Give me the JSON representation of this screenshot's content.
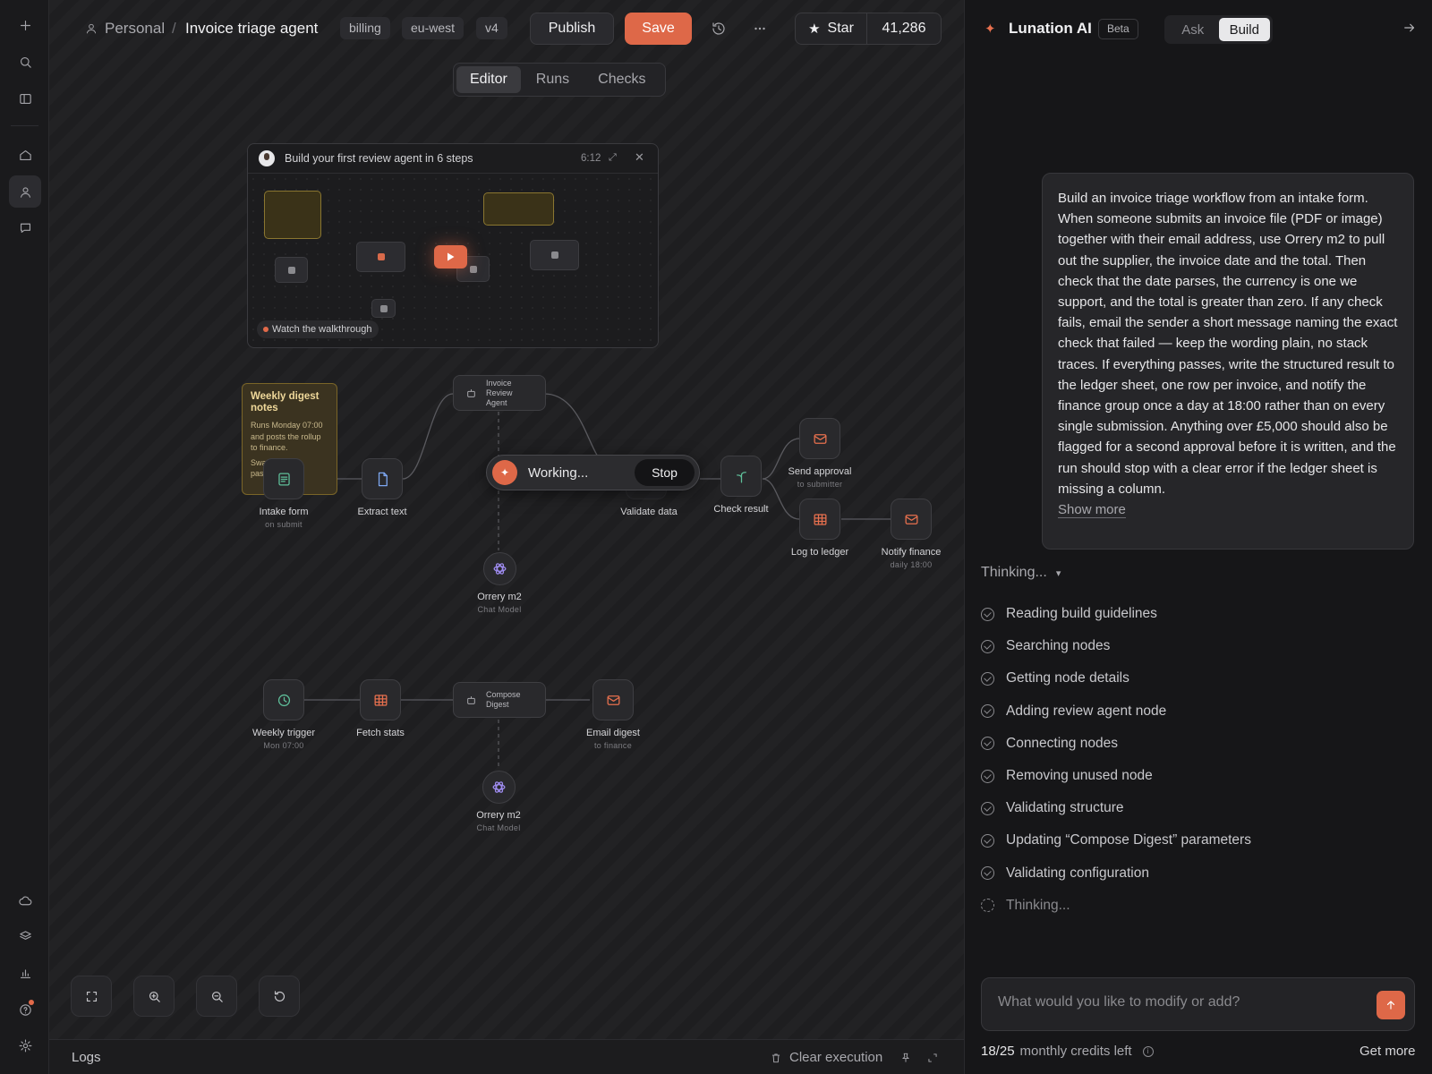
{
  "breadcrumb": {
    "workspace": "Personal",
    "separator": "/",
    "title": "Invoice triage agent"
  },
  "tags": [
    "billing",
    "eu-west",
    "v4"
  ],
  "toolbar": {
    "publish_label": "Publish",
    "save_label": "Save",
    "star_label": "Star",
    "star_count": "41,286"
  },
  "view_tabs": [
    {
      "label": "Editor",
      "active": true
    },
    {
      "label": "Runs",
      "active": false
    },
    {
      "label": "Checks",
      "active": false
    }
  ],
  "walkthrough": {
    "title": "Build your first review agent in 6 steps",
    "duration": "6:12",
    "watch_label": "Watch the walkthrough"
  },
  "sticky_note": {
    "title": "Weekly digest notes",
    "body": "Runs Monday 07:00 and posts the rollup to finance.",
    "body_more": "Swap... node... pass..."
  },
  "workflow": {
    "nodes": {
      "intake_form": {
        "label": "Intake form",
        "sub": "on submit"
      },
      "extract_text": {
        "label": "Extract text"
      },
      "review_agent": {
        "label": "Invoice Review Agent"
      },
      "validate_data": {
        "label": "Validate data"
      },
      "check_result": {
        "label": "Check result"
      },
      "send_approval": {
        "label": "Send approval",
        "sub": "to submitter"
      },
      "log_ledger": {
        "label": "Log to ledger"
      },
      "notify_finance": {
        "label": "Notify finance",
        "sub": "daily 18:00"
      },
      "model_1": {
        "label": "Orrery m2",
        "sub": "Chat Model"
      },
      "weekly_trigger": {
        "label": "Weekly trigger",
        "sub": "Mon 07:00"
      },
      "fetch_stats": {
        "label": "Fetch stats"
      },
      "compose_digest": {
        "label": "Compose Digest"
      },
      "email_digest": {
        "label": "Email digest",
        "sub": "to finance"
      },
      "model_2": {
        "label": "Orrery m2",
        "sub": "Chat Model"
      }
    },
    "working": {
      "status": "Working...",
      "stop_label": "Stop"
    }
  },
  "logs": {
    "title": "Logs",
    "clear_label": "Clear execution"
  },
  "assistant": {
    "name": "Lunation AI",
    "badge": "Beta",
    "modes": [
      {
        "label": "Ask",
        "active": false
      },
      {
        "label": "Build",
        "active": true
      }
    ],
    "prompt": "Build an invoice triage workflow from an intake form. When someone submits an invoice file (PDF or image) together with their email address, use Orrery m2 to pull out the supplier, the invoice date and the total. Then check that the date parses, the currency is one we support, and the total is greater than zero. If any check fails, email the sender a short message naming the exact check that failed — keep the wording plain, no stack traces. If everything passes, write the structured result to the ledger sheet, one row per invoice, and notify the finance group once a day at 18:00 rather than on every single submission. Anything over £5,000 should also be flagged for a second approval before it is written, and the run should stop with a clear error if the ledger sheet is missing a column.",
    "show_more": "Show more",
    "thinking_label": "Thinking...",
    "steps": [
      {
        "label": "Reading build guidelines",
        "done": true
      },
      {
        "label": "Searching nodes",
        "done": true
      },
      {
        "label": "Getting node details",
        "done": true
      },
      {
        "label": "Adding review agent node",
        "done": true
      },
      {
        "label": "Connecting nodes",
        "done": true
      },
      {
        "label": "Removing unused node",
        "done": true
      },
      {
        "label": "Validating structure",
        "done": true
      },
      {
        "label": "Updating “Compose Digest” parameters",
        "done": true
      },
      {
        "label": "Validating configuration",
        "done": true
      },
      {
        "label": "Thinking...",
        "done": false
      }
    ],
    "input_placeholder": "What would you like to modify or add?",
    "credits_used": "18/25",
    "credits_text": "monthly credits left",
    "get_more": "Get more"
  },
  "colors": {
    "accent": "#de6848",
    "sticky": "#3b3320",
    "canvas": "#1e1e20"
  }
}
